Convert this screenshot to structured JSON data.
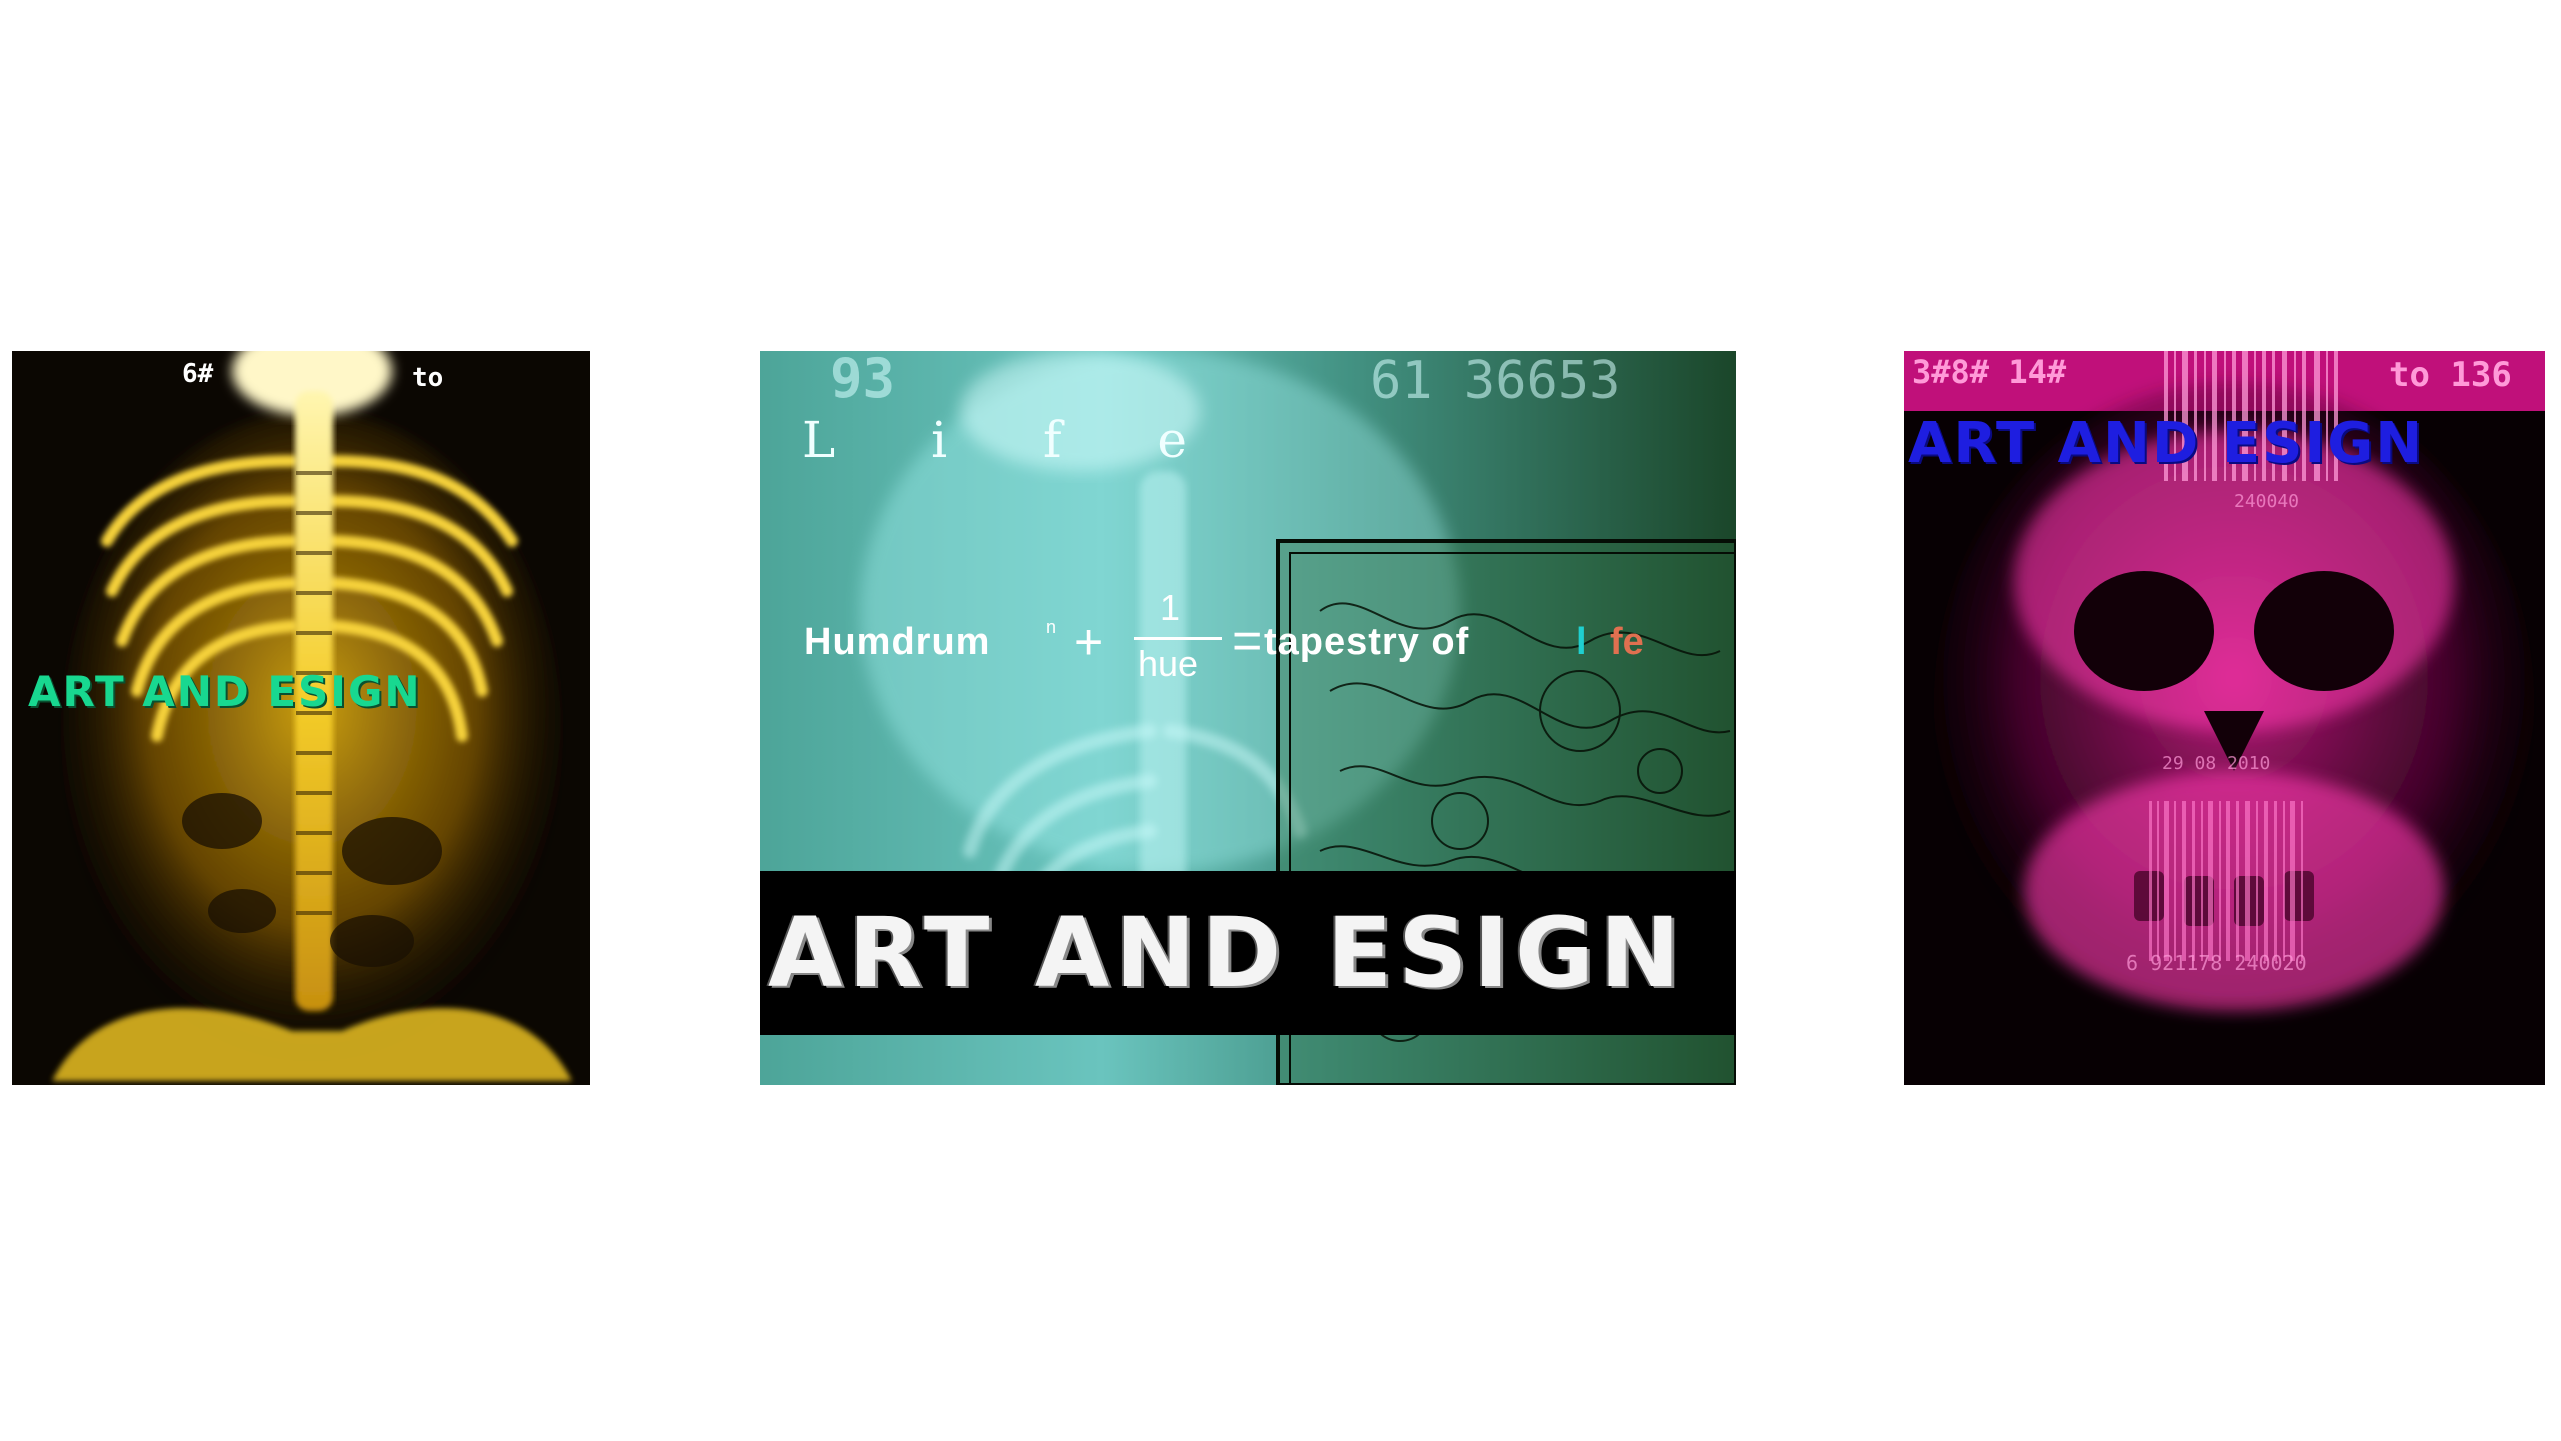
{
  "panels": [
    {
      "id": "yellow",
      "numbers": {
        "left": "6#",
        "right": "to"
      },
      "title": "ART AND ESIGN"
    },
    {
      "id": "cyan",
      "numbers": {
        "left": "93",
        "right": "61 36653"
      },
      "life": "L i f e",
      "formula": {
        "humdrum": "Humdrum",
        "exponent": "n",
        "plus": "+",
        "numerator": "1",
        "denominator": "hue",
        "equals": "=",
        "result": "tapestry  of",
        "l": "l",
        "fe": "fe"
      },
      "title": "ART AND ESIGN"
    },
    {
      "id": "magenta",
      "numbers": {
        "left": "3#8# 14#",
        "right": "to 136"
      },
      "title": "ART AND ESIGN",
      "barcode_top": "240040",
      "barcode_mid": "29 08 2010",
      "barcode_bottom": "6 921178 240020"
    }
  ],
  "colors": {
    "yellow": "#f2c21a",
    "cyan": "#7ff0f0",
    "green_dark": "#1d4a2e",
    "magenta": "#ff2ea8",
    "blue": "#1e1ee0",
    "teal_text": "#18d890",
    "l_color": "#1fd0d0",
    "fe_color": "#e07050"
  }
}
